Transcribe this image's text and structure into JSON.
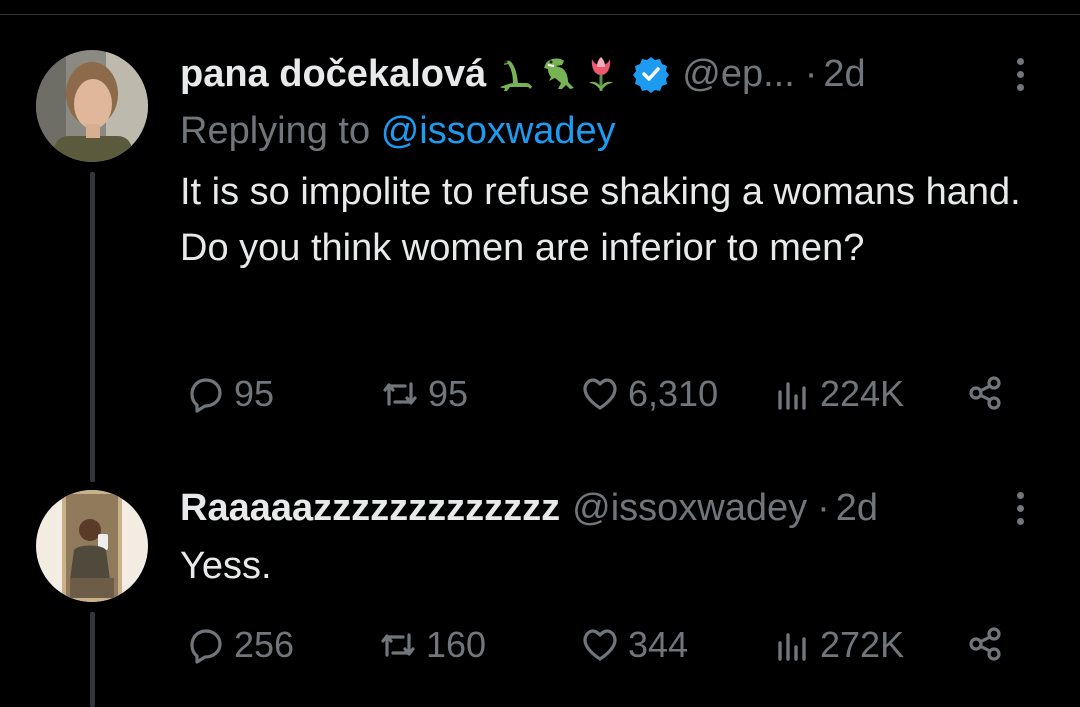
{
  "tweets": [
    {
      "author": "pana dočekalová",
      "emoji_icons": [
        "sauropod-icon",
        "t-rex-icon",
        "tulip-icon"
      ],
      "verified": true,
      "handle": "@ep...",
      "separator": "·",
      "age": "2d",
      "reply_prefix": "Replying to",
      "reply_handle": "@issoxwadey",
      "text": "It is so impolite to refuse shaking a womans hand. Do you think women are inferior to men?",
      "stats": {
        "replies": "95",
        "reposts": "95",
        "likes": "6,310",
        "views": "224K"
      }
    },
    {
      "author": "Raaaaazzzzzzzzzzzzz",
      "handle": "@issoxwadey",
      "separator": "·",
      "age": "2d",
      "text": "Yess.",
      "stats": {
        "replies": "256",
        "reposts": "160",
        "likes": "344",
        "views": "272K"
      }
    }
  ],
  "colors": {
    "background": "#000000",
    "text": "#e7e9ea",
    "muted": "#71767b",
    "link": "#1d9bf0",
    "verified": "#1d9bf0"
  }
}
